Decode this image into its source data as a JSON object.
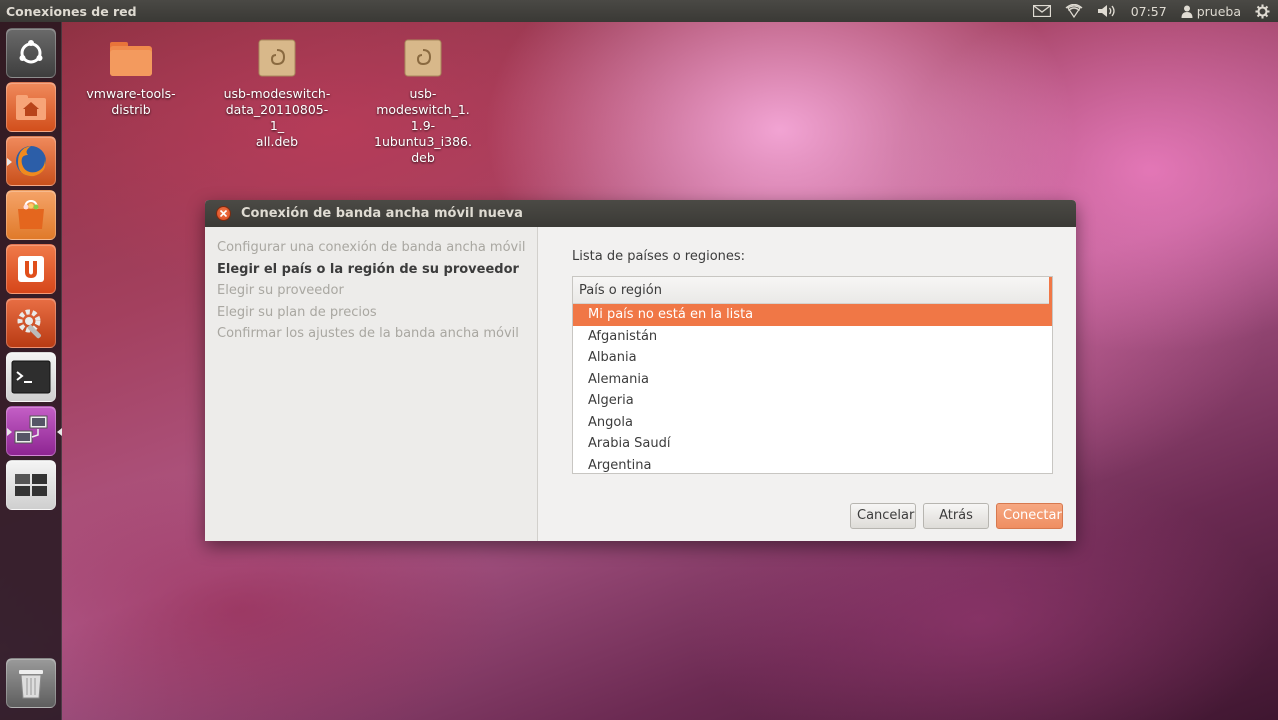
{
  "panel": {
    "app_title": "Conexiones de red",
    "time": "07:57",
    "user": "prueba"
  },
  "launcher": {
    "items": [
      {
        "name": "dash-home",
        "color": "#5a5a5a"
      },
      {
        "name": "home-folder",
        "color": "#d9531e"
      },
      {
        "name": "firefox",
        "color": "#c0561e"
      },
      {
        "name": "software-center",
        "color": "#e07a2a"
      },
      {
        "name": "ubuntu-one",
        "color": "#e04e1a"
      },
      {
        "name": "system-settings",
        "color": "#c94720"
      },
      {
        "name": "terminal",
        "color": "#4a4a4a"
      },
      {
        "name": "network-connections",
        "color": "#a02ea3"
      },
      {
        "name": "workspace-switcher",
        "color": "#5c5c5c"
      },
      {
        "name": "trash",
        "color": "#7a7a7a"
      }
    ]
  },
  "desktop": {
    "icons": [
      {
        "label": "vmware-tools-\ndistrib"
      },
      {
        "label": "usb-modeswitch-\ndata_20110805-1_\nall.deb"
      },
      {
        "label": "usb-modeswitch_1.\n1.9-1ubuntu3_i386.\ndeb"
      }
    ]
  },
  "dialog": {
    "title": "Conexión de banda ancha móvil nueva",
    "steps": [
      "Configurar una conexión de banda ancha móvil",
      "Elegir el país o la región de su proveedor",
      "Elegir su proveedor",
      "Elegir su plan de precios",
      "Confirmar los ajustes de la banda ancha móvil"
    ],
    "current_step": 1,
    "list_label": "Lista de países o regiones:",
    "list_header": "País o región",
    "countries": [
      "Mi país no está en la lista",
      "Afganistán",
      "Albania",
      "Alemania",
      "Algeria",
      "Angola",
      "Arabia Saudí",
      "Argentina"
    ],
    "selected_index": 0,
    "buttons": {
      "cancel": "Cancelar",
      "back": "Atrás",
      "connect": "Conectar"
    }
  }
}
